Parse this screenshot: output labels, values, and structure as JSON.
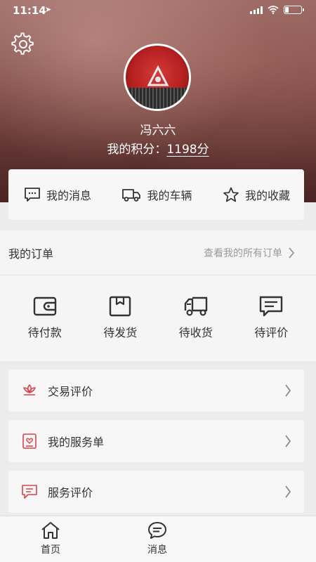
{
  "status_bar": {
    "time": "11:14",
    "battery_level": 0.25
  },
  "profile": {
    "name": "冯六六",
    "points_label": "我的积分：",
    "points_value": "1198分"
  },
  "quick_links": [
    {
      "label": "我的消息",
      "icon": "message-icon"
    },
    {
      "label": "我的车辆",
      "icon": "truck-icon"
    },
    {
      "label": "我的收藏",
      "icon": "star-icon"
    }
  ],
  "orders": {
    "title": "我的订单",
    "view_all": "查看我的所有订单",
    "items": [
      {
        "label": "待付款",
        "icon": "wallet-icon"
      },
      {
        "label": "待发货",
        "icon": "box-icon"
      },
      {
        "label": "待收货",
        "icon": "delivery-truck-icon"
      },
      {
        "label": "待评价",
        "icon": "comment-icon"
      }
    ]
  },
  "menu": [
    {
      "label": "交易评价",
      "icon": "lotus-icon"
    },
    {
      "label": "我的服务单",
      "icon": "service-order-icon"
    },
    {
      "label": "服务评价",
      "icon": "service-comment-icon"
    }
  ],
  "tabs": [
    {
      "label": "首页",
      "icon": "home-icon"
    },
    {
      "label": "消息",
      "icon": "chat-icon"
    }
  ],
  "colors": {
    "accent_red": "#d9434b",
    "text": "#333333",
    "muted": "#999999"
  }
}
